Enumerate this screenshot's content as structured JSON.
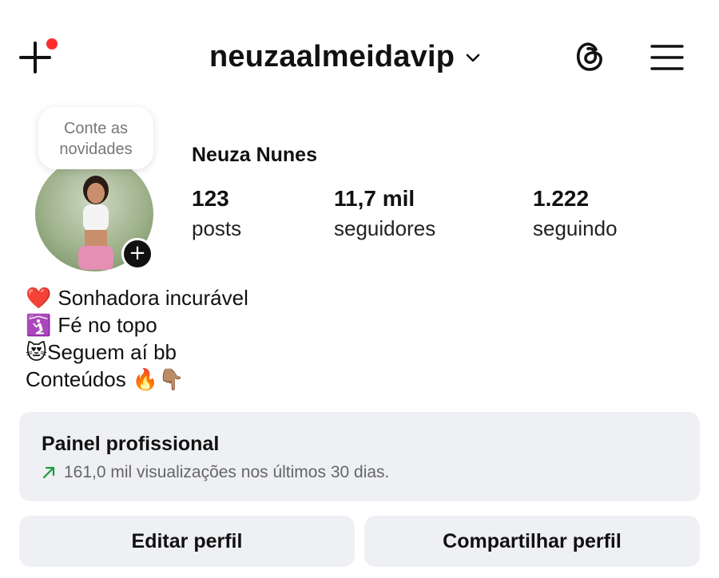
{
  "status_bar": {
    "text": ""
  },
  "header": {
    "username": "neuzaalmeidavip",
    "icons": {
      "add": "plus-icon",
      "dropdown": "chevron-down-icon",
      "threads": "threads-icon",
      "menu": "hamburger-menu-icon"
    },
    "notification_dot_color": "#ff2d2d"
  },
  "note": {
    "line1": "Conte as",
    "line2": "novidades"
  },
  "profile": {
    "display_name": "Neuza Nunes",
    "stats": [
      {
        "value": "123",
        "label": "posts"
      },
      {
        "value": "11,7 mil",
        "label": "seguidores"
      },
      {
        "value": "1.222",
        "label": "seguindo"
      }
    ]
  },
  "bio": [
    {
      "emoji": "❤️",
      "text": "Sonhadora incurável"
    },
    {
      "emoji": "🛐",
      "text": "Fé no topo"
    },
    {
      "emoji": "😻",
      "text": "Seguem aí bb"
    },
    {
      "text": "Conteúdos",
      "emoji_after": "🔥👇🏽"
    }
  ],
  "professional_panel": {
    "title": "Painel profissional",
    "subtitle": "161,0 mil visualizações nos últimos 30 dias.",
    "trend_color": "#1a9c3e"
  },
  "actions": {
    "edit": "Editar perfil",
    "share": "Compartilhar perfil"
  }
}
